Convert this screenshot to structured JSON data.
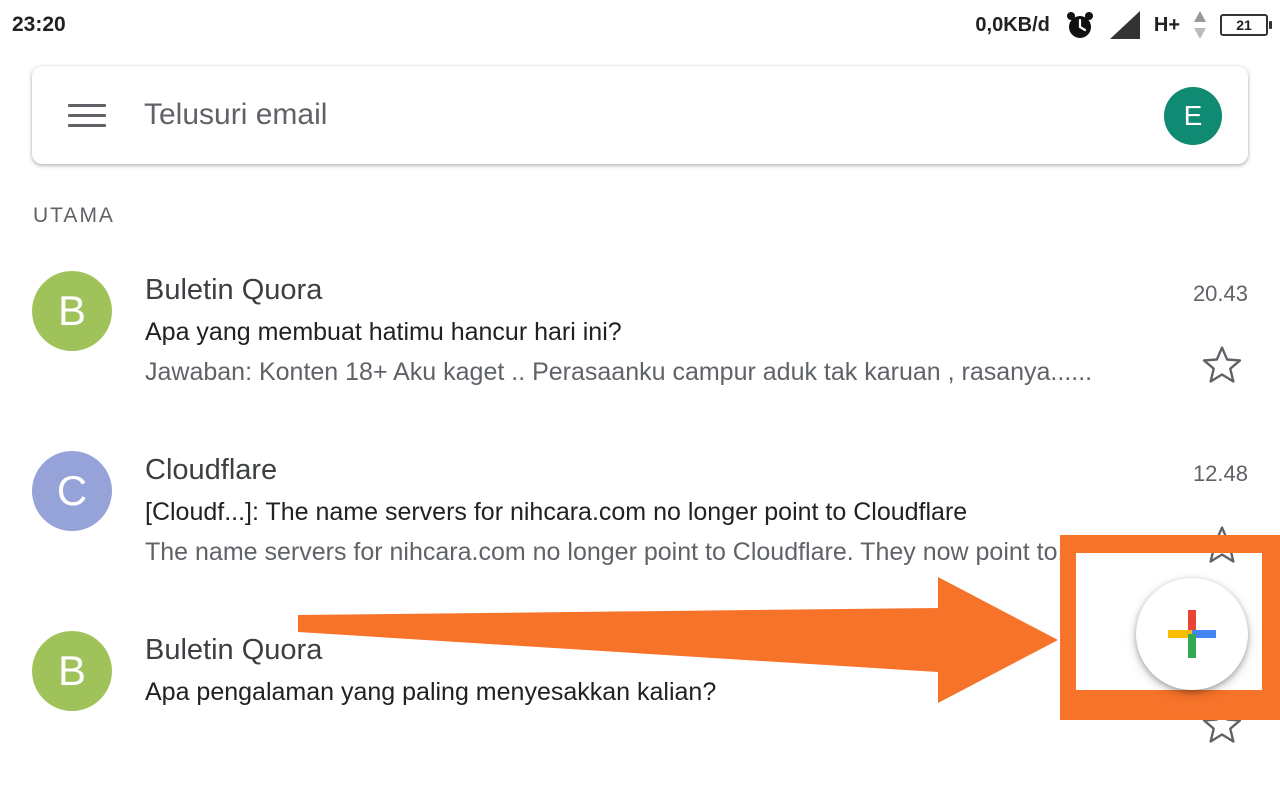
{
  "status_bar": {
    "time": "23:20",
    "data_speed": "0,0KB/d",
    "network_type": "H+",
    "battery_level": "21",
    "icons": [
      "alarm-icon",
      "signal-icon",
      "data-arrows-icon",
      "battery-icon"
    ]
  },
  "search": {
    "placeholder": "Telusuri email",
    "account_initial": "E",
    "account_color": "#0f8a73"
  },
  "section_label": "UTAMA",
  "emails": [
    {
      "initial": "B",
      "color": "#9fc35a",
      "sender": "Buletin Quora",
      "subject": "Apa yang membuat hatimu hancur hari ini?",
      "snippet": "Jawaban: Konten 18+ Aku kaget .. Perasaanku campur aduk tak karuan , rasanya......",
      "time": "20.43"
    },
    {
      "initial": "C",
      "color": "#95a3d9",
      "sender": "Cloudflare",
      "subject": "[Cloudf...]: The name servers for nihcara.com no longer point to Cloudflare",
      "snippet": "The name servers for nihcara.com no longer point to Cloudflare. They now point to...",
      "time": "12.48"
    },
    {
      "initial": "B",
      "color": "#9fc35a",
      "sender": "Buletin Quora",
      "subject": "Apa pengalaman yang paling menyesakkan kalian?",
      "snippet": "",
      "time": ""
    }
  ],
  "annotation": {
    "color": "#f7732a"
  },
  "compose": {
    "icon": "compose-plus-icon",
    "colors": {
      "red": "#ea4335",
      "blue": "#4285f4",
      "yellow": "#fbbc04",
      "green": "#34a853"
    }
  }
}
